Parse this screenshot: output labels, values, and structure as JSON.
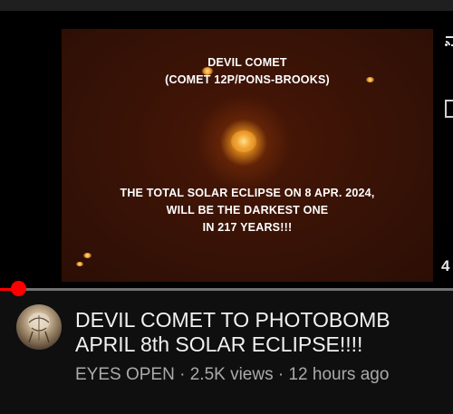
{
  "player": {
    "overlay_title_line1": "DEVIL COMET",
    "overlay_title_line2": "(COMET 12P/PONS-BROOKS)",
    "overlay_caption_line1": "THE TOTAL SOLAR ECLIPSE ON 8 APR. 2024,",
    "overlay_caption_line2": "WILL BE THE DARKEST ONE",
    "overlay_caption_line3": "IN 217 YEARS!!!",
    "right_edge_digit": "4"
  },
  "progress": {
    "fraction": 0.04,
    "played_color": "#ff0000",
    "track_color": "#717171"
  },
  "video": {
    "title_line1": "DEVIL COMET TO PHOTOBOMB",
    "title_line2": "APRIL 8th SOLAR ECLIPSE!!!!",
    "channel": "EYES OPEN",
    "separator": "·",
    "views": "2.5K views",
    "age": "12 hours ago"
  },
  "icons": {
    "top_right": "cast-icon",
    "right_middle": "panel-icon"
  }
}
